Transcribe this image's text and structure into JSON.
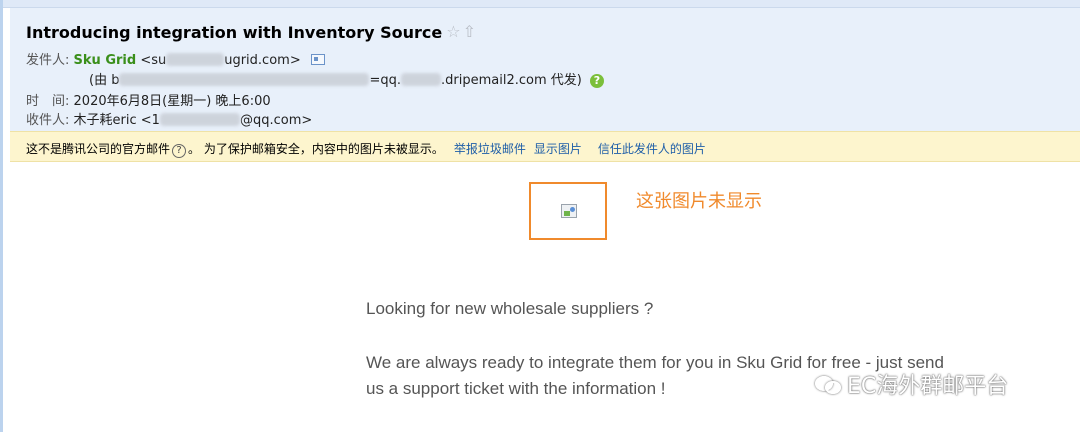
{
  "email": {
    "subject": "Introducing integration with Inventory Source",
    "icons": {
      "star": "star-icon",
      "up": "up-arrow-icon"
    },
    "from_label": "发件人:",
    "sender_name": "Sku Grid",
    "sender_email_prefix": "<su",
    "sender_email_suffix": "ugrid.com>",
    "via_prefix": "(由 b",
    "via_middle": "=qq.",
    "via_suffix": ".dripemail2.com 代发)",
    "time_label": "时　间:",
    "time_value": "2020年6月8日(星期一) 晚上6:00",
    "to_label": "收件人:",
    "to_name": "木子耗eric",
    "to_email_prefix": "<1",
    "to_email_suffix": "@qq.com>"
  },
  "warning": {
    "text_part1": "这不是腾讯公司的官方邮件",
    "question_icon": "?",
    "text_part2": "。 为了保护邮箱安全，内容中的图片未被显示。",
    "link_report_spam": "举报垃圾邮件",
    "link_show_images": "显示图片",
    "link_trust_sender": "信任此发件人的图片"
  },
  "content": {
    "image_not_shown_note": "这张图片未显示",
    "line1": "Looking for new wholesale suppliers ?",
    "line2": "We are always ready to integrate them for you in Sku Grid for free - just send",
    "line3": "us a support ticket with the information !"
  },
  "watermark": {
    "text": "EC海外群邮平台"
  },
  "colors": {
    "header_bg": "#e8f0fa",
    "warning_bg": "#fdf5ce",
    "sender_green": "#3a8f1a",
    "link_blue": "#1e5ea8",
    "annotation_orange": "#f08a2c"
  }
}
